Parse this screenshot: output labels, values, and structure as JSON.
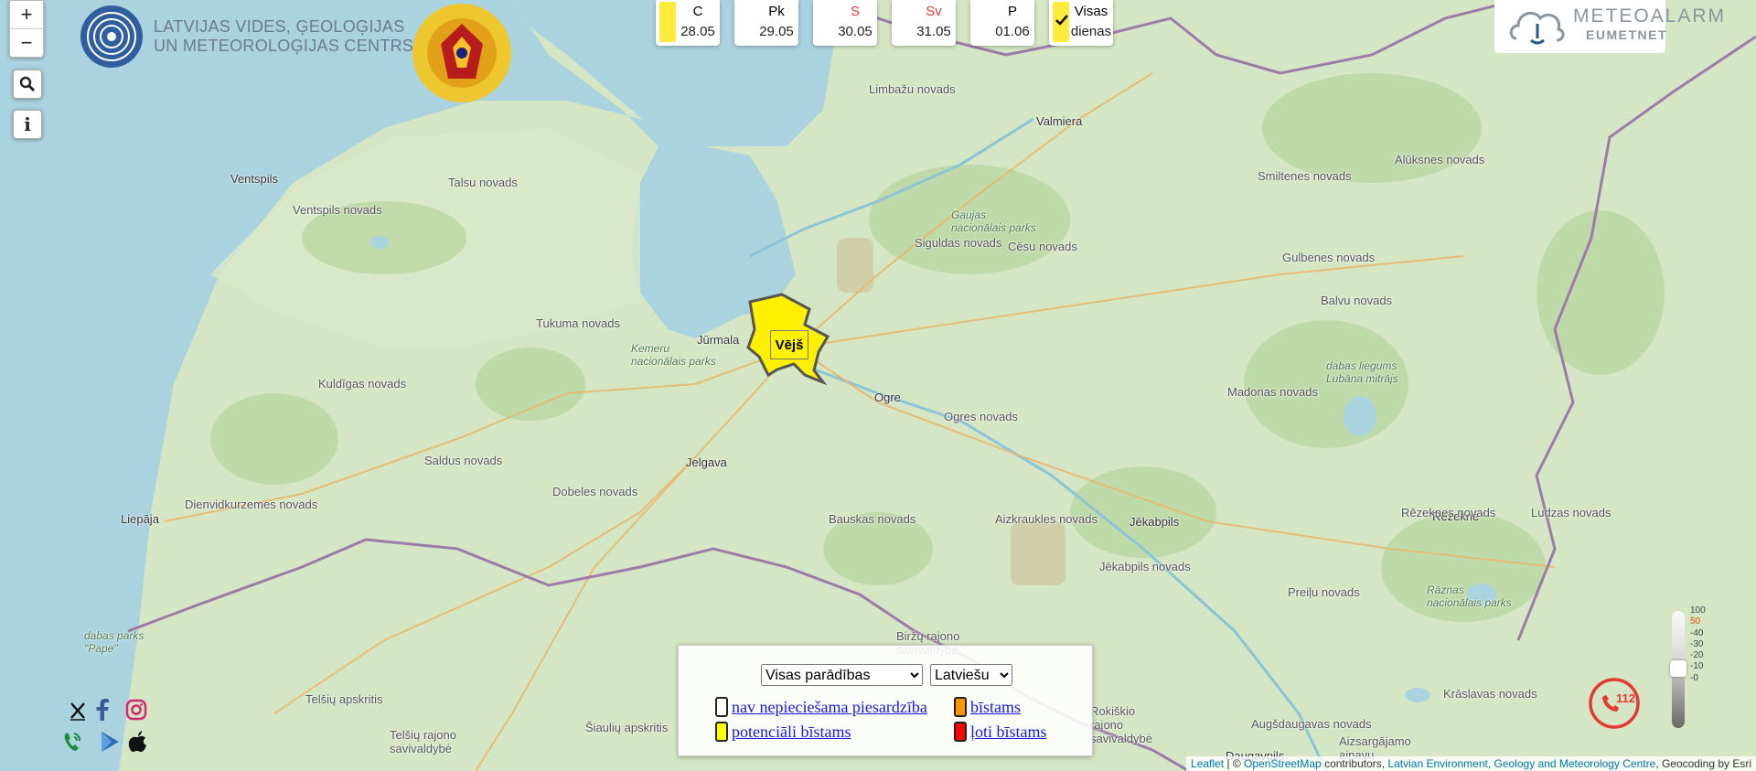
{
  "logos": {
    "lvgmc_line1": "LATVIJAS VIDES, ĢEOLOĢIJAS",
    "lvgmc_line2": "UN METEOROLOĢIJAS CENTRS",
    "meteoalarm_line1": "METEOALARM",
    "meteoalarm_line2": "EUMETNET"
  },
  "map_controls": {
    "zoom_in": "+",
    "zoom_out": "−",
    "search_icon": "search-icon",
    "info_label": "i"
  },
  "days": [
    {
      "name": "C",
      "date": "28.05",
      "warning_color": "#ffeb3b",
      "name_color": "#222222"
    },
    {
      "name": "Pk",
      "date": "29.05",
      "warning_color": "",
      "name_color": "#222222"
    },
    {
      "name": "S",
      "date": "30.05",
      "warning_color": "",
      "name_color": "#e53935"
    },
    {
      "name": "Sv",
      "date": "31.05",
      "warning_color": "",
      "name_color": "#e53935"
    },
    {
      "name": "P",
      "date": "01.06",
      "warning_color": "",
      "name_color": "#222222"
    }
  ],
  "all_days": {
    "line1": "Visas",
    "line2": "dienas",
    "checked": true
  },
  "warning_region": {
    "label": "Vējš",
    "color": "#ffeb3b"
  },
  "map_places": {
    "cities": [
      "Ventspils",
      "Jūrmala",
      "Ogre",
      "Jelgava",
      "Liepāja",
      "Valmiera",
      "Jēkabpils",
      "Rēzekne",
      "Daugavpils"
    ],
    "novads": [
      "Talsu novads",
      "Ventspils novads",
      "Limbažu novads",
      "Siguldas novads",
      "Smiltenes novads",
      "Alūksnes novads",
      "Cēsu novads",
      "Gulbenes novads",
      "Tukuma novads",
      "Balvu novads",
      "Kuldīgas novads",
      "Ogres novads",
      "Madonas novads",
      "Saldus novads",
      "Dobeles novads",
      "Dienvidkurzemes novads",
      "Bauskas novads",
      "Aizkraukles novads",
      "Rēzeknes novads",
      "Ludzas novads",
      "Jēkabpils novads",
      "Preiļu novads",
      "Krāslavas novads",
      "Augšdaugavas novads"
    ],
    "parks": [
      "Kemeru nacionālais parks",
      "Gaujas nacionālais parks",
      "dabas liegums Lubāna mitrājs",
      "Rāznas nacionālais parks",
      "dabas parks \"Pape\""
    ],
    "foreign": [
      "Telšių apskritis",
      "Šiaulių apskritis",
      "Telšių rajono savivaldybė",
      "Biržų rajono savivaldybė",
      "Rokiškio rajono savivaldybė",
      "Aizsargājamo ainavu"
    ]
  },
  "legend": {
    "filter_selected": "Visas parādības",
    "language_selected": "Latviešu",
    "items": [
      {
        "label": "nav nepieciešama piesardzība",
        "color": "#ffffff"
      },
      {
        "label": "bīstams",
        "color": "#ff9800"
      },
      {
        "label": "potenciāli bīstams",
        "color": "#ffff00"
      },
      {
        "label": "ļoti bīstams",
        "color": "#ff0000"
      }
    ]
  },
  "social": [
    "x-icon",
    "facebook-icon",
    "instagram-icon",
    "phone-icon",
    "google-play-icon",
    "apple-icon"
  ],
  "emergency": {
    "number": "112"
  },
  "scale": {
    "ticks": [
      "100",
      "50",
      "-40",
      "-30",
      "-20",
      "-10",
      "-0"
    ],
    "unit": "temperature-scale"
  },
  "attribution": {
    "leaflet": "Leaflet",
    "sep1": " | © ",
    "osm": "OpenStreetMap",
    "contrib": " contributors, ",
    "lvgmc": "Latvian Environment, Geology and Meteorology Centre",
    "geocoding": ", Geocoding by Esri"
  }
}
